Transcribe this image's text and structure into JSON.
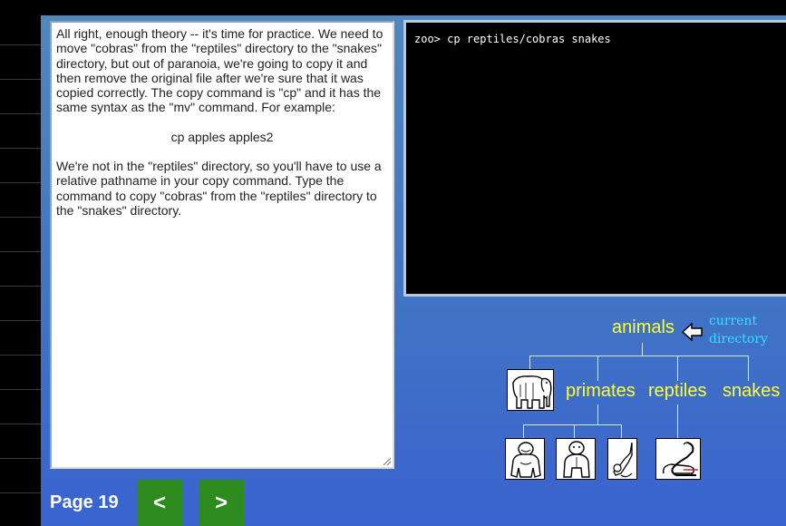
{
  "lesson": {
    "paragraphs": [
      "All right, enough theory -- it's time for practice. We need to move \"cobras\" from the \"reptiles\" directory to the \"snakes\" directory, but out of paranoia, we're going to copy it and then remove the original file after we're sure that it was copied correctly. The copy command is \"cp\" and it has the same syntax as the \"mv\" command. For example:",
      "cp apples apples2",
      "We're not in the \"reptiles\" directory, so you'll have to use a relative pathname in your copy command. Type the command to copy \"cobras\" from the \"reptiles\" directory to the \"snakes\" directory."
    ]
  },
  "terminal": {
    "prompt": "zoo>",
    "command": " cp reptiles/cobras snakes"
  },
  "tree": {
    "root": "animals",
    "hint_line1": "current",
    "hint_line2": "directory",
    "children": [
      "primates",
      "reptiles",
      "snakes"
    ],
    "icons": {
      "elephant": "elephant-icon",
      "gorilla": "gorilla-icon",
      "ape": "ape-icon",
      "monkey": "monkey-icon",
      "cobra": "cobra-icon",
      "pointer": "left-arrow-icon"
    }
  },
  "nav": {
    "page_label": "Page 19",
    "prev_label": "<",
    "next_label": ">"
  },
  "colors": {
    "panel_top": "#4f88bd",
    "panel_bottom": "#3a63cf",
    "tree_text": "#ffff33",
    "hint_text": "#33e0ff",
    "nav_button": "#2e8b1e"
  }
}
